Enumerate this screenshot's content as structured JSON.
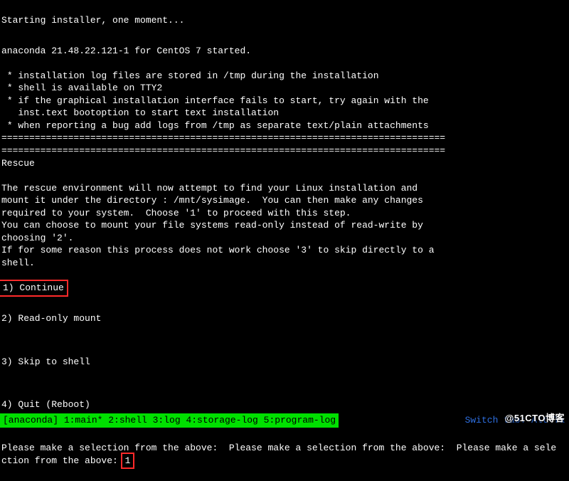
{
  "boot": {
    "starting": "Starting installer, one moment...",
    "banner": "anaconda 21.48.22.121-1 for CentOS 7 started.",
    "bullets": [
      " * installation log files are stored in /tmp during the installation",
      " * shell is available on TTY2",
      " * if the graphical installation interface fails to start, try again with the\n   inst.text bootoption to start text installation",
      " * when reporting a bug add logs from /tmp as separate text/plain attachments"
    ]
  },
  "separator1": "================================================================================",
  "separator2": "================================================================================",
  "rescue": {
    "title": "Rescue",
    "body_1": "The rescue environment will now attempt to find your Linux installation and\nmount it under the directory : /mnt/sysimage.  You can then make any changes\nrequired to your system.  Choose '1' to proceed with this step.",
    "body_2": "You can choose to mount your file systems read-only instead of read-write by\nchoosing '2'.",
    "body_3": "If for some reason this process does not work choose '3' to skip directly to a\nshell.",
    "options": [
      "1) Continue",
      "2) Read-only mount",
      "3) Skip to shell",
      "4) Quit (Reboot)"
    ]
  },
  "prompt_line": "Please make a selection from the above:  Please make a selection from the above:  Please make a sele\nction from the above: ",
  "user_input": "1",
  "status": {
    "left": "[anaconda] 1:main* 2:shell  3:log  4:storage-log  5:program-log",
    "right": "Switch tab: Alt+Ta"
  },
  "watermark": "@51CTO博客"
}
